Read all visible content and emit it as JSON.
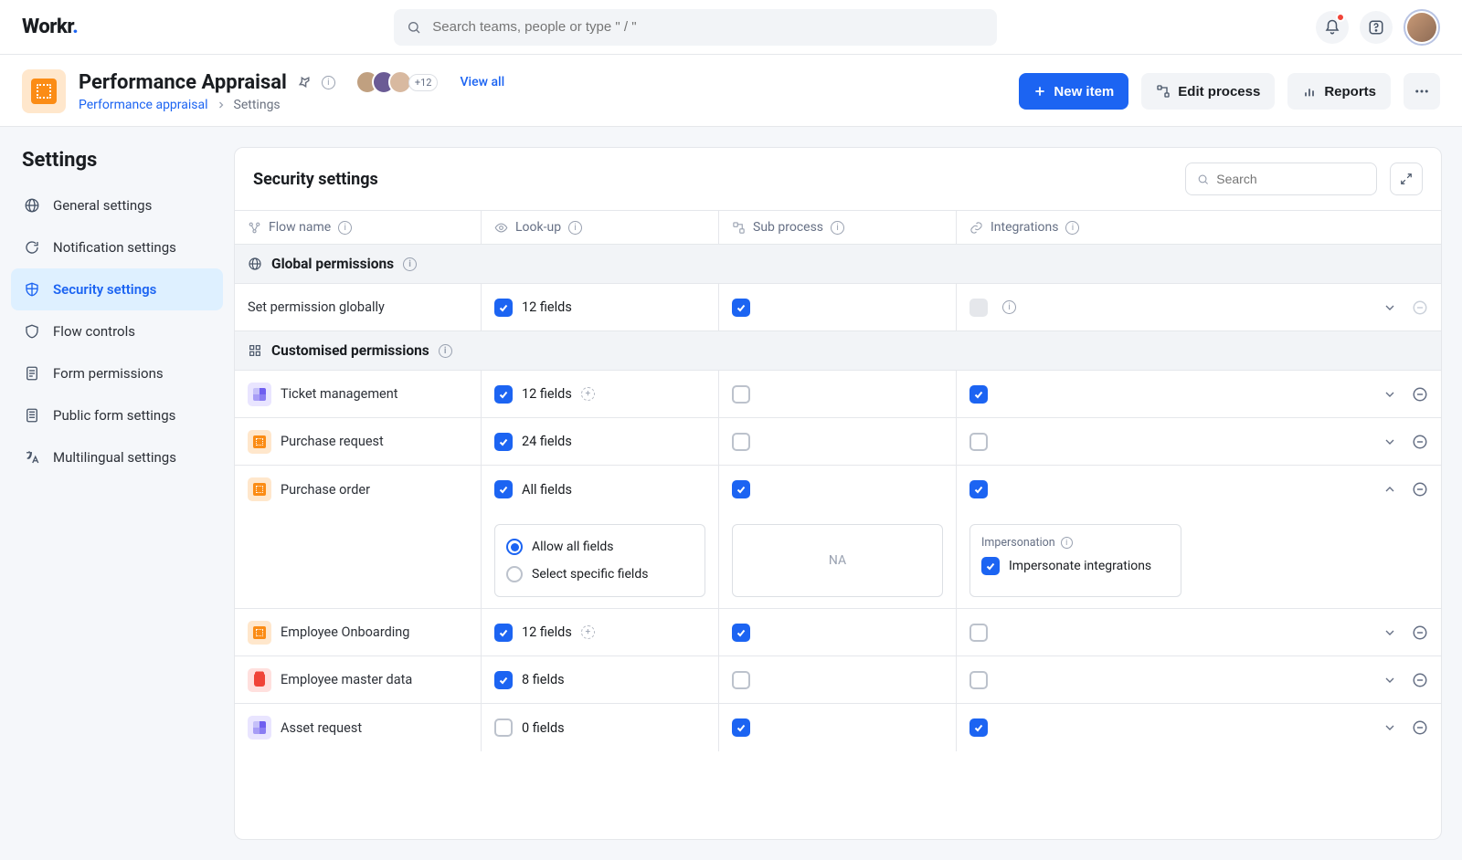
{
  "logo": "Workr",
  "search_placeholder": "Search teams, people or type \" / \"",
  "header": {
    "title": "Performance Appraisal",
    "breadcrumb_parent": "Performance appraisal",
    "breadcrumb_current": "Settings",
    "avatar_overflow": "+12",
    "view_all": "View all",
    "new_item": "New item",
    "edit_process": "Edit process",
    "reports": "Reports"
  },
  "sidebar": {
    "title": "Settings",
    "items": [
      {
        "label": "General settings"
      },
      {
        "label": "Notification settings"
      },
      {
        "label": "Security settings"
      },
      {
        "label": "Flow controls"
      },
      {
        "label": "Form permissions"
      },
      {
        "label": "Public form settings"
      },
      {
        "label": "Multilingual settings"
      }
    ]
  },
  "panel": {
    "title": "Security settings",
    "search_placeholder": "Search",
    "columns": {
      "flow": "Flow name",
      "lookup": "Look-up",
      "subprocess": "Sub process",
      "integrations": "Integrations"
    },
    "section_global": "Global permissions",
    "section_custom": "Customised permissions",
    "global_row_label": "Set permission globally",
    "rows": {
      "global_fields": "12 fields",
      "ticket": {
        "name": "Ticket management",
        "fields": "12 fields"
      },
      "pr": {
        "name": "Purchase request",
        "fields": "24 fields"
      },
      "po": {
        "name": "Purchase order",
        "fields": "All fields"
      },
      "emp_onb": {
        "name": "Employee Onboarding",
        "fields": "12 fields"
      },
      "emp_master": {
        "name": "Employee master data",
        "fields": "8 fields"
      },
      "asset": {
        "name": "Asset request",
        "fields": "0 fields"
      }
    },
    "po_expand": {
      "radio_all": "Allow all fields",
      "radio_specific": "Select specific fields",
      "na": "NA",
      "imp_title": "Impersonation",
      "imp_check_label": "Impersonate integrations"
    }
  }
}
